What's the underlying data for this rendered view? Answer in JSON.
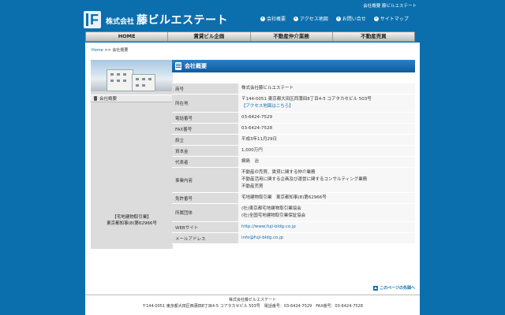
{
  "top": {
    "corner_text": "会社概要 藤ビルエステート"
  },
  "logo": {
    "prefix": "株式会社",
    "name": "藤ビルエステート"
  },
  "topnav": [
    "会社概要",
    "アクセス地図",
    "お問い合せ",
    "サイトマップ"
  ],
  "mainnav": [
    "HOME",
    "賃貸ビル企画",
    "不動産仲介業務",
    "不動産売買"
  ],
  "breadcrumb": {
    "home": "Home",
    "sep": " >> ",
    "current": "会社概要"
  },
  "sidebar": {
    "item": "会社概要",
    "license_line1": "【宅地建物取引業】",
    "license_line2": "東京都知事(8)第62966号"
  },
  "content": {
    "heading": "会社概要",
    "rows": [
      {
        "key": "商号",
        "lines": [
          "株式会社藤ビルエステート"
        ]
      },
      {
        "key": "所在地",
        "lines": [
          "〒144-0051 東京都大田区西蒲田8丁目4-5 コアタカセビル 503号",
          "【アクセス地図はこちら】"
        ]
      },
      {
        "key": "電話番号",
        "lines": [
          "03-6424-7529"
        ]
      },
      {
        "key": "FAX番号",
        "lines": [
          "03-6424-7528"
        ]
      },
      {
        "key": "設立",
        "lines": [
          "平成3年11月29日"
        ]
      },
      {
        "key": "資本金",
        "lines": [
          "1,000万円"
        ]
      },
      {
        "key": "代表者",
        "lines": [
          "網島　治"
        ]
      },
      {
        "key": "事業内容",
        "lines": [
          "不動産の売買、賃貸に関する仲介業務",
          "不動産活用に関する企画及び運営に関するコンサルティング業務",
          "不動産売買"
        ]
      },
      {
        "key": "免許番号",
        "lines": [
          "宅地建物取引業　東京都知事(8)第62966号"
        ]
      },
      {
        "key": "所属団体",
        "lines": [
          "(社)東京都宅地建物取引業協会",
          "(社)全国宅地建物取引業保証協会"
        ]
      },
      {
        "key": "WEBサイト",
        "lines": [
          "http://www.fuji-bldg.co.jp"
        ]
      },
      {
        "key": "メールアドレス",
        "lines": [
          "info@fuji-bldg.co.jp"
        ]
      }
    ]
  },
  "totop": "このページの先頭へ",
  "footer": {
    "company": "株式会社藤ビルエステート",
    "address": "〒144-0051 東京都大田区西蒲田8丁目4-5 コアタカセビル 503号　電話番号：03-6424-7529　FAX番号：03-6424-7528"
  }
}
